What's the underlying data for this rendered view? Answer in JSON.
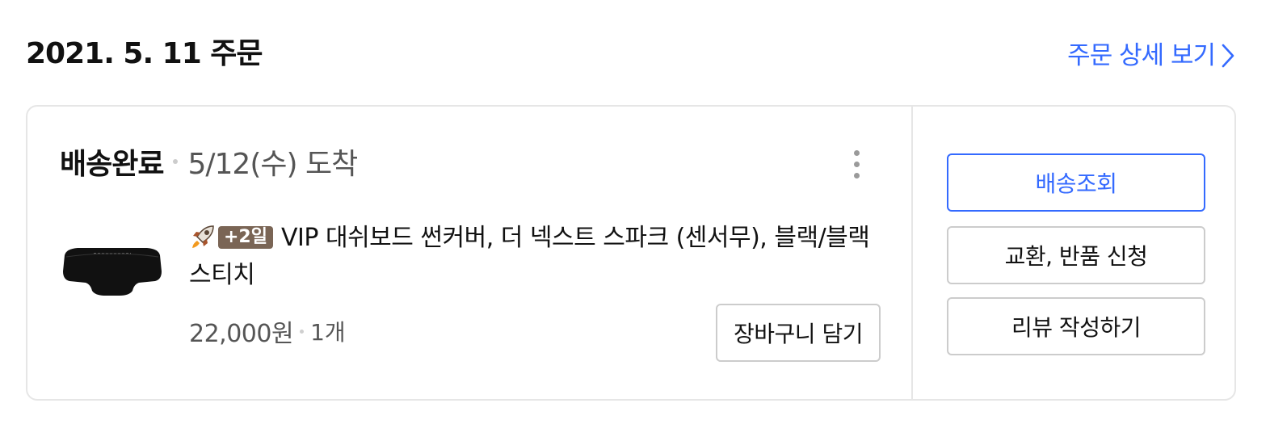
{
  "header": {
    "order_date_title": "2021. 5. 11 주문",
    "detail_link_label": "주문 상세 보기"
  },
  "order": {
    "status": "배송완료",
    "arrival": "5/12(수) 도착",
    "product": {
      "badge_text": "+2일",
      "name": "VIP 대쉬보드 썬커버, 더 넥스트 스파크 (센서무), 블랙/블랙 스티치",
      "price": "22,000원",
      "quantity": "1개"
    },
    "add_to_cart_label": "장바구니 담기"
  },
  "actions": {
    "track_label": "배송조회",
    "exchange_label": "교환, 반품 신청",
    "review_label": "리뷰 작성하기"
  },
  "colors": {
    "accent": "#346aff",
    "border": "#e6e6e6",
    "badge": "#7a6555"
  },
  "icons": {
    "rocket": "rocket-delivery-icon",
    "more": "more-vertical-icon",
    "chevron": "chevron-right-icon"
  }
}
